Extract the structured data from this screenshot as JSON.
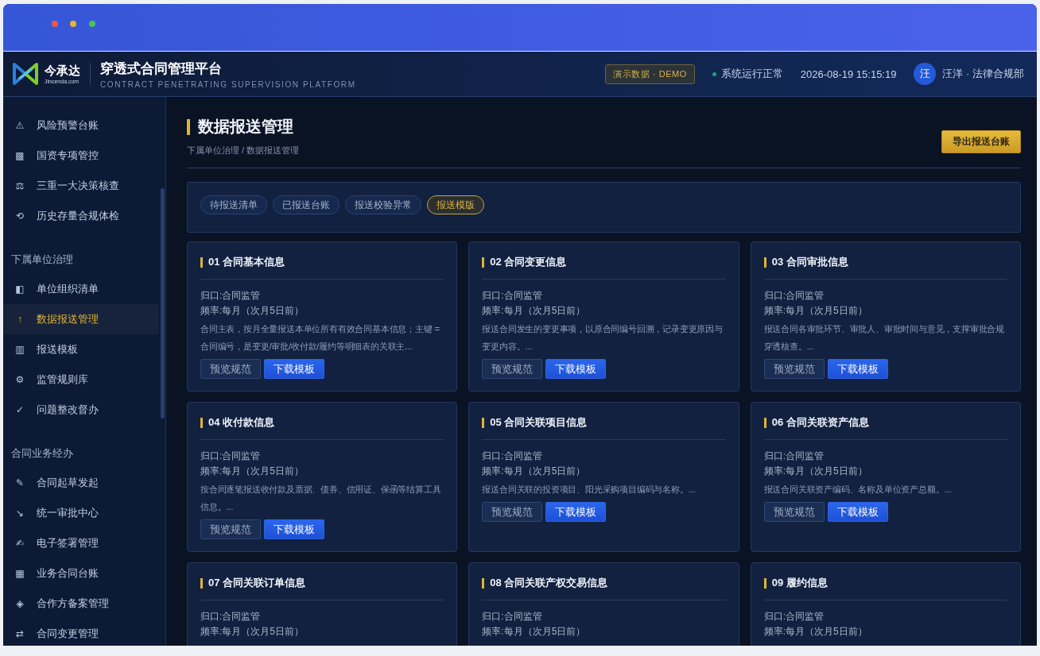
{
  "header": {
    "logo_name": "今承达",
    "logo_domain": "Jincenda.com",
    "title": "穿透式合同管理平台",
    "subtitle": "CONTRACT PENETRATING SUPERVISION PLATFORM",
    "demo_badge": "演示数据 · DEMO",
    "status": "系统运行正常",
    "datetime": "2026-08-19 15:15:19",
    "avatar": "汪",
    "user": "汪洋 · 法律合规部"
  },
  "sidebar": {
    "sections": [
      {
        "items": [
          {
            "icon": "⚠",
            "label": "风险预警台账",
            "selected": false
          },
          {
            "icon": "▩",
            "label": "国资专项管控",
            "selected": false
          },
          {
            "icon": "⚖",
            "label": "三重一大决策核查",
            "selected": false
          },
          {
            "icon": "⟲",
            "label": "历史存量合规体检",
            "selected": false
          }
        ]
      },
      {
        "label": "下属单位治理",
        "items": [
          {
            "icon": "◧",
            "label": "单位组织清单",
            "selected": false
          },
          {
            "icon": "↑",
            "label": "数据报送管理",
            "selected": true
          },
          {
            "icon": "▥",
            "label": "报送模板",
            "selected": false
          },
          {
            "icon": "⚙",
            "label": "监管规则库",
            "selected": false
          },
          {
            "icon": "✓",
            "label": "问题整改督办",
            "selected": false
          }
        ]
      },
      {
        "label": "合同业务经办",
        "items": [
          {
            "icon": "✎",
            "label": "合同起草发起",
            "selected": false
          },
          {
            "icon": "↘",
            "label": "统一审批中心",
            "selected": false
          },
          {
            "icon": "✍",
            "label": "电子签署管理",
            "selected": false
          },
          {
            "icon": "▦",
            "label": "业务合同台账",
            "selected": false
          },
          {
            "icon": "◈",
            "label": "合作方备案管理",
            "selected": false
          },
          {
            "icon": "⇄",
            "label": "合同变更管理",
            "selected": false
          }
        ]
      }
    ]
  },
  "page": {
    "title": "数据报送管理",
    "breadcrumb": "下属单位治理 / 数据报送管理",
    "export_button": "导出报送台账"
  },
  "tabs": [
    {
      "label": "待报送清单",
      "selected": false
    },
    {
      "label": "已报送台账",
      "selected": false
    },
    {
      "label": "报送校验异常",
      "selected": false
    },
    {
      "label": "报送模版",
      "selected": true
    }
  ],
  "cards": [
    {
      "title": "01 合同基本信息",
      "owner": "归口:合同监管",
      "frequency": "频率:每月（次月5日前）",
      "description": "合同主表，按月全量报送本单位所有有效合同基本信息；主键 = 合同编号，是变更/审批/收付款/履约等明细表的关联主...",
      "preview_button": "预览规范",
      "download_button": "下载模板"
    },
    {
      "title": "02 合同变更信息",
      "owner": "归口:合同监管",
      "frequency": "频率:每月（次月5日前）",
      "description": "报送合同发生的变更事项，以原合同编号回溯，记录变更原因与变更内容。...",
      "preview_button": "预览规范",
      "download_button": "下载模板"
    },
    {
      "title": "03 合同审批信息",
      "owner": "归口:合同监管",
      "frequency": "频率:每月（次月5日前）",
      "description": "报送合同各审批环节、审批人、审批时间与意见，支撑审批合规穿透核查。...",
      "preview_button": "预览规范",
      "download_button": "下载模板"
    },
    {
      "title": "04 收付款信息",
      "owner": "归口:合同监管",
      "frequency": "频率:每月（次月5日前）",
      "description": "按合同逐笔报送收付款及票据、债券、信用证、保函等结算工具信息。...",
      "preview_button": "预览规范",
      "download_button": "下载模板"
    },
    {
      "title": "05 合同关联项目信息",
      "owner": "归口:合同监管",
      "frequency": "频率:每月（次月5日前）",
      "description": "报送合同关联的投资项目、阳光采购项目编码与名称。...",
      "preview_button": "预览规范",
      "download_button": "下载模板"
    },
    {
      "title": "06 合同关联资产信息",
      "owner": "归口:合同监管",
      "frequency": "频率:每月（次月5日前）",
      "description": "报送合同关联资产编码、名称及单位资产总额。...",
      "preview_button": "预览规范",
      "download_button": "下载模板"
    },
    {
      "title": "07 合同关联订单信息",
      "owner": "归口:合同监管",
      "frequency": "频率:每月（次月5日前）"
    },
    {
      "title": "08 合同关联产权交易信息",
      "owner": "归口:合同监管",
      "frequency": "频率:每月（次月5日前）"
    },
    {
      "title": "09 履约信息",
      "owner": "归口:合同监管",
      "frequency": "频率:每月（次月5日前）"
    }
  ]
}
